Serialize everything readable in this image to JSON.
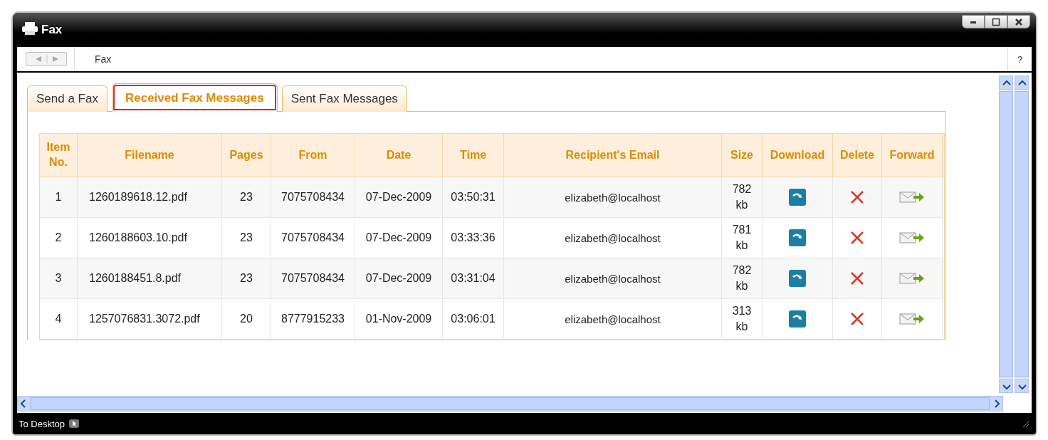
{
  "window": {
    "title": "Fax"
  },
  "toolbar": {
    "breadcrumb": "Fax",
    "help": "?"
  },
  "tabs": [
    {
      "label": "Send a Fax",
      "selected": false
    },
    {
      "label": "Received Fax Messages",
      "selected": true
    },
    {
      "label": "Sent Fax Messages",
      "selected": false
    }
  ],
  "table": {
    "columns": [
      "Item No.",
      "Filename",
      "Pages",
      "From",
      "Date",
      "Time",
      "Recipient's Email",
      "Size",
      "Download",
      "Delete",
      "Forward"
    ],
    "rows": [
      {
        "item": "1",
        "filename": "1260189618.12.pdf",
        "pages": "23",
        "from": "7075708434",
        "date": "07-Dec-2009",
        "time": "03:50:31",
        "email": "elizabeth@localhost",
        "size": "782 kb"
      },
      {
        "item": "2",
        "filename": "1260188603.10.pdf",
        "pages": "23",
        "from": "7075708434",
        "date": "07-Dec-2009",
        "time": "03:33:36",
        "email": "elizabeth@localhost",
        "size": "781 kb"
      },
      {
        "item": "3",
        "filename": "1260188451.8.pdf",
        "pages": "23",
        "from": "7075708434",
        "date": "07-Dec-2009",
        "time": "03:31:04",
        "email": "elizabeth@localhost",
        "size": "782 kb"
      },
      {
        "item": "4",
        "filename": "1257076831.3072.pdf",
        "pages": "20",
        "from": "8777915233",
        "date": "01-Nov-2009",
        "time": "03:06:01",
        "email": "elizabeth@localhost",
        "size": "313 kb"
      }
    ]
  },
  "status_bar": {
    "label": "To Desktop"
  }
}
